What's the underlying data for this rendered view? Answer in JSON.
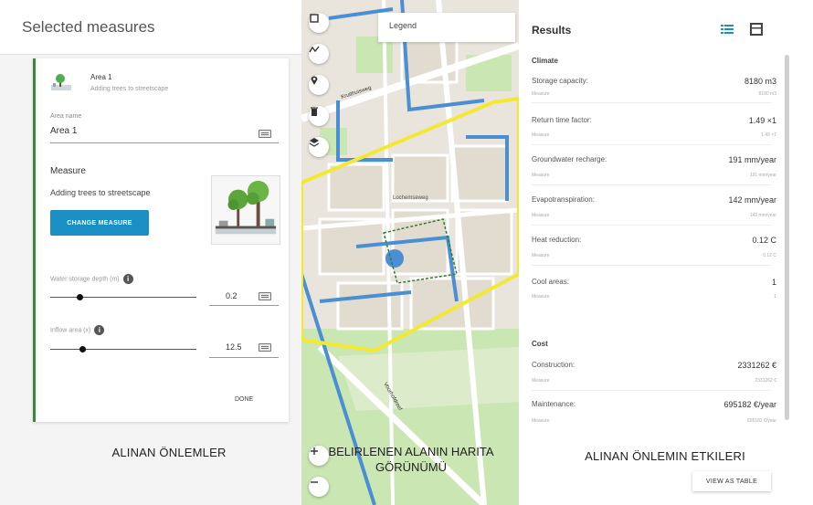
{
  "left_panel": {
    "title": "Selected measures",
    "area": {
      "name": "Area 1",
      "subtitle": "Adding trees to streetscape",
      "area_name_label": "Area name",
      "area_name_value": "Area 1",
      "measure_heading": "Measure",
      "measure_value": "Adding trees to streetscape",
      "change_button": "CHANGE MEASURE",
      "slider1_label": "Water storage depth (m)",
      "slider1_value": "0.2",
      "slider1_fraction": 0.2,
      "slider2_label": "Inflow area (x)",
      "slider2_value": "12.5",
      "slider2_fraction": 0.22,
      "done_button": "DONE"
    },
    "caption": "ALINAN ÖNLEMLER"
  },
  "map": {
    "legend_label": "Legend",
    "street_labels": [
      "Kruithuisweg",
      "Lochemseweg",
      "Voorhofdreef"
    ],
    "caption": "BELIRLENEN ALANIN HARITA GÖRÜNÜMÜ",
    "colors": {
      "water": "#4a8fd4",
      "selection": "#f3e832",
      "park": "#c9e6b3",
      "road": "#ffffff"
    },
    "controls": [
      "square-icon",
      "polyline-icon",
      "marker-icon",
      "trash-icon",
      "layers-icon",
      "zoom-in-icon",
      "zoom-out-icon"
    ]
  },
  "results": {
    "title": "Results",
    "climate_heading": "Climate",
    "climate": [
      {
        "label": "Storage capacity:",
        "value": "8180 m3",
        "sub_label": "Measure",
        "sub_value": "8180 m3"
      },
      {
        "label": "Return time factor:",
        "value": "1.49 ×1",
        "sub_label": "Measure",
        "sub_value": "1.49 ×1"
      },
      {
        "label": "Groundwater recharge:",
        "value": "191 mm/year",
        "sub_label": "Measure",
        "sub_value": "191 mm/year"
      },
      {
        "label": "Evapotranspiration:",
        "value": "142 mm/year",
        "sub_label": "Measure",
        "sub_value": "142 mm/year"
      },
      {
        "label": "Heat reduction:",
        "value": "0.12 C",
        "sub_label": "Measure",
        "sub_value": "0.12 C"
      },
      {
        "label": "Cool areas:",
        "value": "1",
        "sub_label": "Measure",
        "sub_value": "1"
      }
    ],
    "cost_heading": "Cost",
    "cost": [
      {
        "label": "Construction:",
        "value": "2331262 €",
        "sub_label": "Measure",
        "sub_value": "2331262 €"
      },
      {
        "label": "Maintenance:",
        "value": "695182 €/year",
        "sub_label": "Measure",
        "sub_value": "695182 €/year"
      }
    ],
    "caption": "ALINAN ÖNLEMIN ETKILERI",
    "view_table_button": "VIEW AS TABLE",
    "accent_color": "#1a8fc3"
  }
}
